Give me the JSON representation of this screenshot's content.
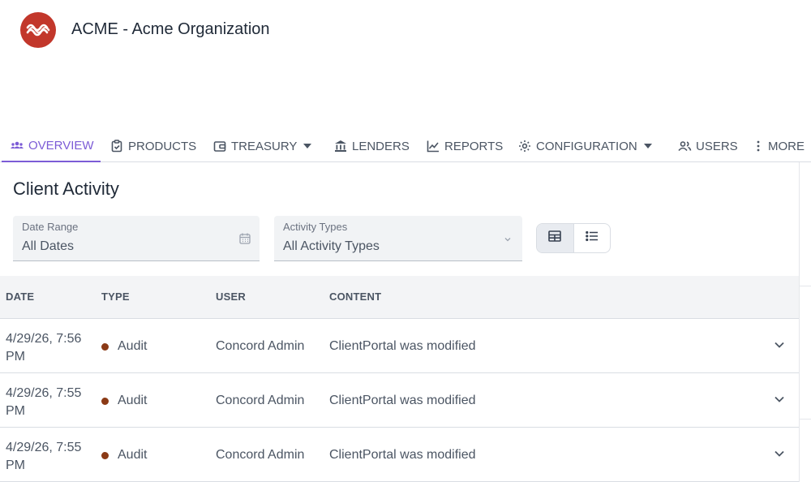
{
  "header": {
    "org_title": "ACME - Acme Organization"
  },
  "nav": {
    "tabs": [
      {
        "label": "OVERVIEW",
        "icon": "users-group-icon",
        "active": true
      },
      {
        "label": "PRODUCTS",
        "icon": "clipboard-icon"
      },
      {
        "label": "TREASURY",
        "icon": "wallet-icon",
        "dropdown": true
      },
      {
        "label": "LENDERS",
        "icon": "bank-icon"
      },
      {
        "label": "REPORTS",
        "icon": "chart-line-icon"
      },
      {
        "label": "CONFIGURATION",
        "icon": "gear-icon",
        "dropdown": true
      },
      {
        "label": "USERS",
        "icon": "users-icon"
      },
      {
        "label": "MORE",
        "icon": "more-vertical-icon"
      }
    ]
  },
  "page": {
    "title": "Client Activity"
  },
  "filters": {
    "date_range": {
      "label": "Date Range",
      "value": "All Dates"
    },
    "activity_types": {
      "label": "Activity Types",
      "value": "All Activity Types"
    }
  },
  "table": {
    "columns": [
      "DATE",
      "TYPE",
      "USER",
      "CONTENT"
    ],
    "rows": [
      {
        "date": "4/29/26, 7:56 PM",
        "type": "Audit",
        "user": "Concord Admin",
        "content": "ClientPortal was modified"
      },
      {
        "date": "4/29/26, 7:55 PM",
        "type": "Audit",
        "user": "Concord Admin",
        "content": "ClientPortal was modified"
      },
      {
        "date": "4/29/26, 7:55 PM",
        "type": "Audit",
        "user": "Concord Admin",
        "content": "ClientPortal was modified"
      }
    ]
  },
  "colors": {
    "accent": "#7c5cd6",
    "logo": "#c2372b",
    "audit_dot": "#8b3a16"
  }
}
